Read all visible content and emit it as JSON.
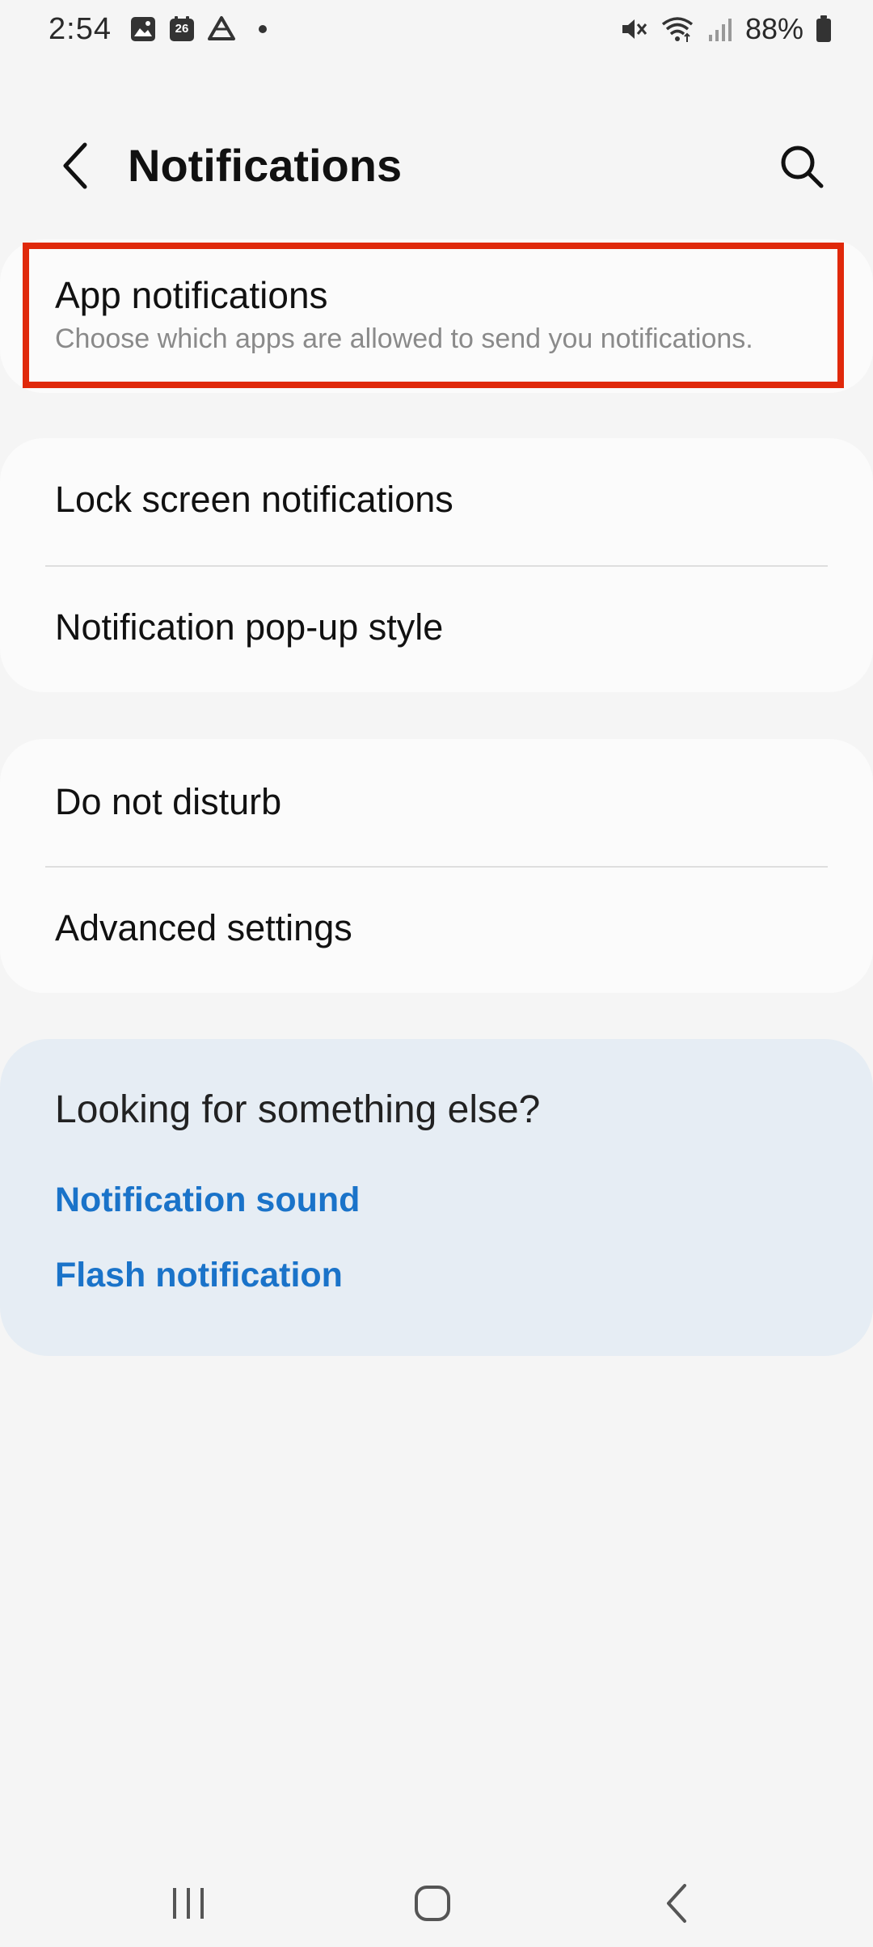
{
  "status_bar": {
    "time": "2:54",
    "calendar_day": "26",
    "battery_text": "88%",
    "icons": [
      "gallery-icon",
      "calendar-icon",
      "drive-icon",
      "dot-icon",
      "mute-icon",
      "wifi-icon",
      "signal-icon",
      "battery-icon"
    ]
  },
  "header": {
    "title": "Notifications",
    "back_icon": "back-chevron-icon",
    "search_icon": "search-icon"
  },
  "app_notifications": {
    "title": "App notifications",
    "subtitle": "Choose which apps are allowed to send you notifications.",
    "highlight_color": "#e0290b"
  },
  "group1": {
    "items": [
      {
        "label": "Lock screen notifications"
      },
      {
        "label": "Notification pop-up style"
      }
    ]
  },
  "group2": {
    "items": [
      {
        "label": "Do not disturb"
      },
      {
        "label": "Advanced settings"
      }
    ]
  },
  "suggestions": {
    "title": "Looking for something else?",
    "links": [
      {
        "label": "Notification sound"
      },
      {
        "label": "Flash notification"
      }
    ],
    "link_color": "#1a73c9"
  },
  "nav_bar": {
    "buttons": [
      "recents-icon",
      "home-icon",
      "back-icon"
    ]
  }
}
